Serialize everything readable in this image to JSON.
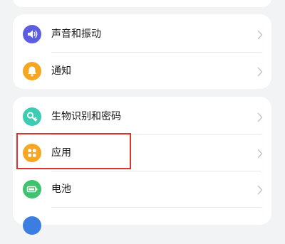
{
  "settings": {
    "items": [
      {
        "label": "声音和振动",
        "icon": "speaker-icon",
        "color": "#5b5ee0"
      },
      {
        "label": "通知",
        "icon": "bell-icon",
        "color": "#f5a623"
      },
      {
        "label": "生物识别和密码",
        "icon": "key-icon",
        "color": "#3ecbb4"
      },
      {
        "label": "应用",
        "icon": "apps-grid-icon",
        "color": "#f5a623"
      },
      {
        "label": "电池",
        "icon": "battery-icon",
        "color": "#3ec36e"
      }
    ]
  },
  "highlight": {
    "target": "应用",
    "color": "#d9352b"
  }
}
